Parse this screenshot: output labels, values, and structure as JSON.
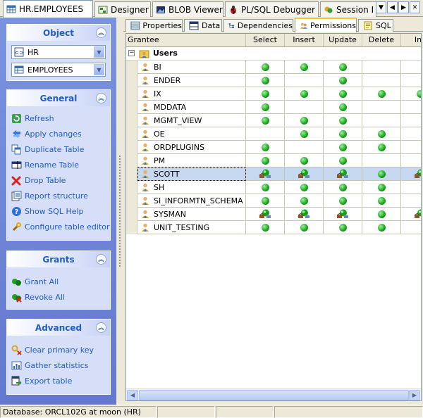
{
  "doc_tabs": [
    {
      "label": "HR.EMPLOYEES",
      "icon": "table-icon",
      "active": true
    },
    {
      "label": "Designer",
      "icon": "designer-icon",
      "active": false
    },
    {
      "label": "BLOB Viewer",
      "icon": "blob-icon",
      "active": false
    },
    {
      "label": "PL/SQL Debugger",
      "icon": "bug-icon",
      "active": false
    },
    {
      "label": "Session I",
      "icon": "session-icon",
      "active": false
    }
  ],
  "object_panel": {
    "title": "Object",
    "schema": "HR",
    "table": "EMPLOYEES"
  },
  "general_panel": {
    "title": "General",
    "items": [
      {
        "label": "Refresh",
        "icon": "refresh-icon"
      },
      {
        "label": "Apply changes",
        "icon": "apply-icon"
      },
      {
        "label": "Duplicate Table",
        "icon": "duplicate-icon"
      },
      {
        "label": "Rename Table",
        "icon": "rename-icon"
      },
      {
        "label": "Drop Table",
        "icon": "drop-icon"
      },
      {
        "label": "Report structure",
        "icon": "report-icon"
      },
      {
        "label": "Show SQL Help",
        "icon": "help-icon"
      },
      {
        "label": "Configure table editor",
        "icon": "configure-icon"
      }
    ]
  },
  "grants_panel": {
    "title": "Grants",
    "items": [
      {
        "label": "Grant All",
        "icon": "grant-all-icon"
      },
      {
        "label": "Revoke All",
        "icon": "revoke-all-icon"
      }
    ]
  },
  "advanced_panel": {
    "title": "Advanced",
    "items": [
      {
        "label": "Clear primary key",
        "icon": "clear-key-icon"
      },
      {
        "label": "Gather statistics",
        "icon": "statistics-icon"
      },
      {
        "label": "Export table",
        "icon": "export-icon"
      }
    ]
  },
  "inner_tabs": [
    {
      "label": "Properties",
      "active": false
    },
    {
      "label": "Data",
      "active": false
    },
    {
      "label": "Dependencies",
      "active": false
    },
    {
      "label": "Permissions",
      "active": true
    },
    {
      "label": "SQL",
      "active": false
    }
  ],
  "grid": {
    "columns": [
      "Grantee",
      "Select",
      "Insert",
      "Update",
      "Delete",
      "Ind"
    ],
    "group_label": "Users",
    "rows": [
      {
        "name": "BI",
        "perms": [
          "g",
          "g",
          "g",
          "",
          ""
        ]
      },
      {
        "name": "ENDER",
        "perms": [
          "g",
          "",
          "g",
          "",
          ""
        ]
      },
      {
        "name": "IX",
        "perms": [
          "g",
          "g",
          "g",
          "g",
          "g"
        ]
      },
      {
        "name": "MDDATA",
        "perms": [
          "g",
          "",
          "g",
          "",
          ""
        ]
      },
      {
        "name": "MGMT_VIEW",
        "perms": [
          "g",
          "g",
          "g",
          "",
          ""
        ]
      },
      {
        "name": "OE",
        "perms": [
          "",
          "g",
          "g",
          "g",
          ""
        ]
      },
      {
        "name": "ORDPLUGINS",
        "perms": [
          "g",
          "",
          "g",
          "g",
          ""
        ]
      },
      {
        "name": "PM",
        "perms": [
          "g",
          "g",
          "g",
          "",
          ""
        ]
      },
      {
        "name": "SCOTT",
        "perms": [
          "o",
          "o",
          "o",
          "g",
          "o"
        ],
        "selected": true
      },
      {
        "name": "SH",
        "perms": [
          "g",
          "g",
          "g",
          "g",
          ""
        ]
      },
      {
        "name": "SI_INFORMTN_SCHEMA",
        "perms": [
          "g",
          "g",
          "g",
          "g",
          ""
        ]
      },
      {
        "name": "SYSMAN",
        "perms": [
          "o",
          "o",
          "o",
          "g",
          "o"
        ]
      },
      {
        "name": "UNIT_TESTING",
        "perms": [
          "g",
          "g",
          "g",
          "g",
          ""
        ]
      }
    ]
  },
  "status": {
    "database": "Database: ORCL102G at moon (HR)"
  },
  "colors": {
    "accent": "#215dc6",
    "pane_bg": "#6f86d6",
    "grant_green": "#16a31a",
    "selection": "#c5d8ef"
  }
}
